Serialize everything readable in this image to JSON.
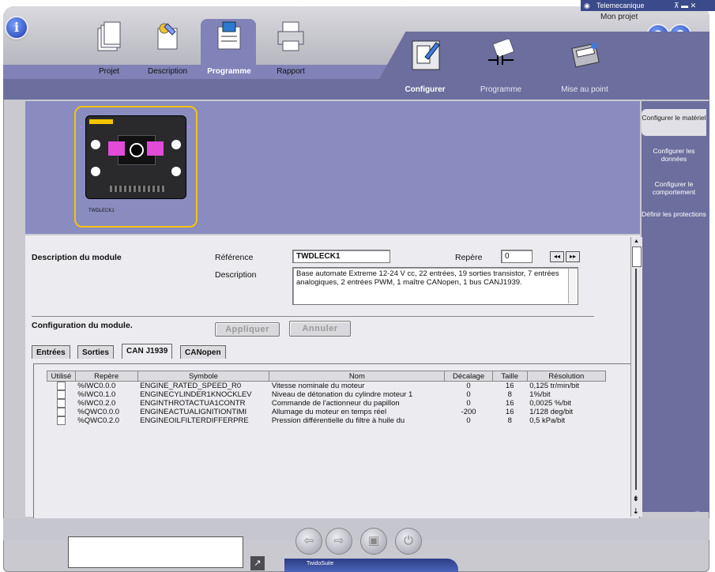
{
  "window": {
    "brand_label": "Telemecanique",
    "project_label": "Mon projet"
  },
  "main_tabs": [
    {
      "label": "Projet"
    },
    {
      "label": "Description"
    },
    {
      "label": "Programme"
    },
    {
      "label": "Rapport"
    }
  ],
  "sub_tabs": [
    {
      "label": "Configurer"
    },
    {
      "label": "Programme"
    },
    {
      "label": "Mise au point"
    }
  ],
  "side_nav": [
    {
      "label": "Configurer le matériel"
    },
    {
      "label": "Configurer les données"
    },
    {
      "label": "Configurer le comportement"
    },
    {
      "label": "Définir les protections"
    }
  ],
  "module": {
    "card_caption": "TWDLECK1",
    "section_title": "Description du module",
    "reference_label": "Référence",
    "reference_value": "TWDLECK1",
    "repere_label": "Repère",
    "repere_value": "0",
    "description_label": "Description",
    "description_value": "Base automate Extreme 12-24 V cc, 22 entrées, 19 sorties transistor, 7 entrées analogiques, 2 entrées PWM, 1 maître CANopen, 1 bus CANJ1939."
  },
  "configuration": {
    "title": "Configuration du module.",
    "apply_label": "Appliquer",
    "cancel_label": "Annuler",
    "tabs": [
      {
        "label": "Entrées"
      },
      {
        "label": "Sorties"
      },
      {
        "label": "CAN J1939"
      },
      {
        "label": "CANopen"
      }
    ],
    "columns": [
      "Utilisé",
      "Repère",
      "Symbole",
      "Nom",
      "Décalage",
      "Taille",
      "Résolution"
    ],
    "rows": [
      {
        "repere": "%IWC0.0.0",
        "symbole": "ENGINE_RATED_SPEED_R0",
        "nom": "Vitesse nominale du moteur",
        "decalage": "0",
        "taille": "16",
        "resolution": "0,125 tr/min/bit"
      },
      {
        "repere": "%IWC0.1.0",
        "symbole": "ENGINECYLINDER1KNOCKLEV",
        "nom": "Niveau de détonation du cylindre moteur 1",
        "decalage": "0",
        "taille": "8",
        "resolution": "1%/bit"
      },
      {
        "repere": "%IWC0.2.0",
        "symbole": "ENGINTHROTACTUA1CONTR",
        "nom": "Commande de l'actionneur du papillon",
        "decalage": "0",
        "taille": "16",
        "resolution": "0,0025 %/bit"
      },
      {
        "repere": "%QWC0.0.0",
        "symbole": "ENGINEACTUALIGNITIONTIMI",
        "nom": "Allumage du moteur en temps réel",
        "decalage": "-200",
        "taille": "16",
        "resolution": "1/128 deg/bit"
      },
      {
        "repere": "%QWC0.2.0",
        "symbole": "ENGINEOILFILTERDIFFERPRE",
        "nom": "Pression différentielle du filtre à huile du",
        "decalage": "0",
        "taille": "8",
        "resolution": "0,5 kPa/bit"
      }
    ]
  },
  "taskbar": {
    "label": "TwidoSuite"
  },
  "icons": {
    "info": "info-icon",
    "connect": "connect-icon",
    "help": "help-icon",
    "nav_first": "rewind-icon",
    "nav_next": "fast-forward-icon",
    "bottom": [
      "back-icon",
      "forward-icon",
      "save-icon",
      "exit-icon"
    ]
  },
  "colors": {
    "tab_purple": "#8082b8",
    "subtab_purple": "#6c6e9e",
    "selection_yellow": "#f4c400",
    "accent_blue": "#1c3aa8"
  }
}
